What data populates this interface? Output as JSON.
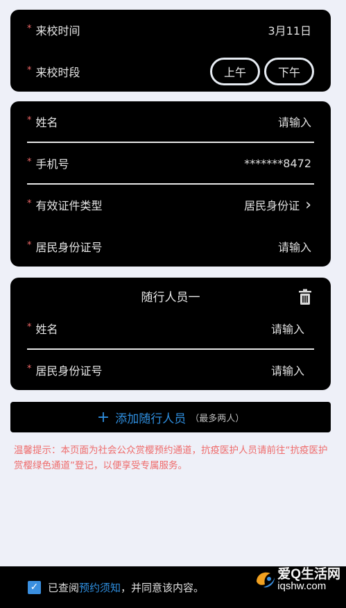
{
  "visit_card": {
    "date_label": "来校时间",
    "date_value": "3月11日",
    "period_label": "来校时段",
    "period_options": [
      "上午",
      "下午"
    ]
  },
  "visitor_card": {
    "name_label": "姓名",
    "name_placeholder": "请输入",
    "phone_label": "手机号",
    "phone_value": "*******8472",
    "id_type_label": "有效证件类型",
    "id_type_value": "居民身份证",
    "id_number_label": "居民身份证号",
    "id_number_placeholder": "请输入"
  },
  "companion_card": {
    "title": "随行人员一",
    "name_label": "姓名",
    "name_placeholder": "请输入",
    "id_number_label": "居民身份证号",
    "id_number_placeholder": "请输入"
  },
  "add_companion": {
    "label": "添加随行人员",
    "note": "（最多两人）"
  },
  "tip": {
    "text": "温馨提示：本页面为社会公众赏樱预约通道，抗疫医护人员请前往“抗疫医护赏樱绿色通道”登记，以便享受专属服务。"
  },
  "footer": {
    "prefix": "已查阅",
    "link": "预约须知",
    "suffix": "，并同意该内容。"
  },
  "watermark": {
    "cn": "爱Q生活网",
    "url": "iqshw.com"
  },
  "colors": {
    "required_star": "#f06868",
    "link_blue": "#2f8fe0",
    "tip_red": "#ef6c6c",
    "page_bg": "#eef0f8"
  }
}
